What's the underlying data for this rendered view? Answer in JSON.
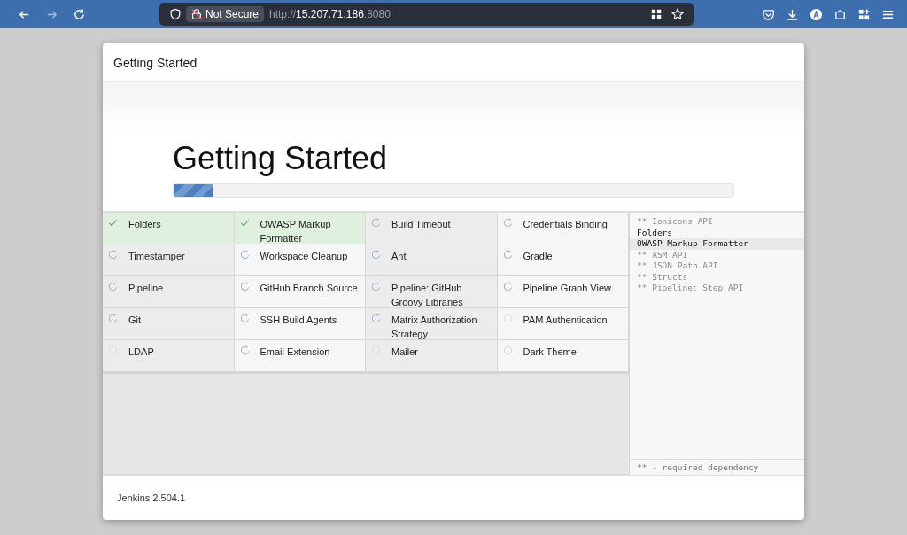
{
  "browser": {
    "security_label": "Not Secure",
    "url_scheme": "http://",
    "url_host": "15.207.71.186",
    "url_port": ":8080"
  },
  "dialog": {
    "title": "Getting Started",
    "heading": "Getting Started",
    "progress": {
      "level": 0.07
    },
    "plugins": [
      {
        "name": "Folders",
        "kind": "installed"
      },
      {
        "name": "OWASP Markup Formatter",
        "kind": "installed"
      },
      {
        "name": "Build Timeout",
        "kind": "installing"
      },
      {
        "name": "Credentials Binding",
        "kind": "installing"
      },
      {
        "name": "Timestamper",
        "kind": "installing"
      },
      {
        "name": "Workspace Cleanup",
        "kind": "installing"
      },
      {
        "name": "Ant",
        "kind": "installing"
      },
      {
        "name": "Gradle",
        "kind": "installing"
      },
      {
        "name": "Pipeline",
        "kind": "installing"
      },
      {
        "name": "GitHub Branch Source",
        "kind": "installing"
      },
      {
        "name": "Pipeline: GitHub Groovy Libraries",
        "kind": "installing"
      },
      {
        "name": "Pipeline Graph View",
        "kind": "installing"
      },
      {
        "name": "Git",
        "kind": "installing"
      },
      {
        "name": "SSH Build Agents",
        "kind": "installing"
      },
      {
        "name": "Matrix Authorization Strategy",
        "kind": "installing"
      },
      {
        "name": "PAM Authentication",
        "kind": "pending"
      },
      {
        "name": "LDAP",
        "kind": "pending"
      },
      {
        "name": "Email Extension",
        "kind": "installing"
      },
      {
        "name": "Mailer",
        "kind": "pending"
      },
      {
        "name": "Dark Theme",
        "kind": "pending"
      }
    ],
    "log": [
      {
        "text": "** Ionicons API",
        "kind": "dependency",
        "highlighted": false
      },
      {
        "text": "Folders",
        "kind": "plugin",
        "highlighted": false
      },
      {
        "text": "OWASP Markup Formatter",
        "kind": "plugin",
        "highlighted": true
      },
      {
        "text": "** ASM API",
        "kind": "dependency",
        "highlighted": false
      },
      {
        "text": "** JSON Path API",
        "kind": "dependency",
        "highlighted": false
      },
      {
        "text": "** Structs",
        "kind": "dependency",
        "highlighted": false
      },
      {
        "text": "** Pipeline: Step API",
        "kind": "dependency",
        "highlighted": false
      }
    ],
    "legend": "** - required dependency",
    "footer": "Jenkins 2.504.1"
  }
}
